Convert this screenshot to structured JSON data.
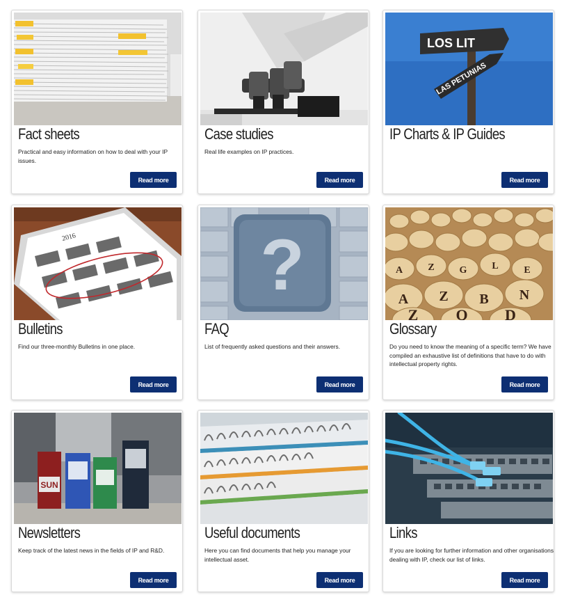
{
  "cards": [
    {
      "title": "Fact sheets",
      "description": "Practical and easy information on how to deal with your IP issues.",
      "button": "Read more",
      "image": "stacked-paper-files"
    },
    {
      "title": "Case studies",
      "description": "Real life examples on IP practices.",
      "button": "Read more",
      "image": "microscope"
    },
    {
      "title": "IP Charts & IP Guides",
      "description": "",
      "button": "Read more",
      "image": "road-signpost",
      "sign_text_1": "LOS LIT",
      "sign_text_2": "LAS PETUNIAS"
    },
    {
      "title": "Bulletins",
      "description": "Find our three-monthly Bulletins in one place.",
      "button": "Read more",
      "image": "calendar-tablet",
      "year": "2016"
    },
    {
      "title": "FAQ",
      "description": "List of frequently asked questions and their answers.",
      "button": "Read more",
      "image": "question-mark-keyboard"
    },
    {
      "title": "Glossary",
      "description": "Do you need to know the meaning of a specific term? We have compiled an exhaustive list of definitions that have to do with intellectual property rights.",
      "button": "Read more",
      "image": "wooden-letter-cubes"
    },
    {
      "title": "Newsletters",
      "description": "Keep track of the latest news in the fields of IP and R&D.",
      "button": "Read more",
      "image": "newspaper-boxes",
      "box_text": "SUN"
    },
    {
      "title": "Useful documents",
      "description": "Here you can find documents that help you manage your intellectual asset.",
      "button": "Read more",
      "image": "spiral-bound-documents"
    },
    {
      "title": "Links",
      "description": "If you are looking for further information and other organisations dealing with IP, check our list of links.",
      "button": "Read more",
      "image": "network-cables"
    }
  ],
  "colors": {
    "button_bg": "#0d2f73",
    "title": "#1f1f1f"
  }
}
